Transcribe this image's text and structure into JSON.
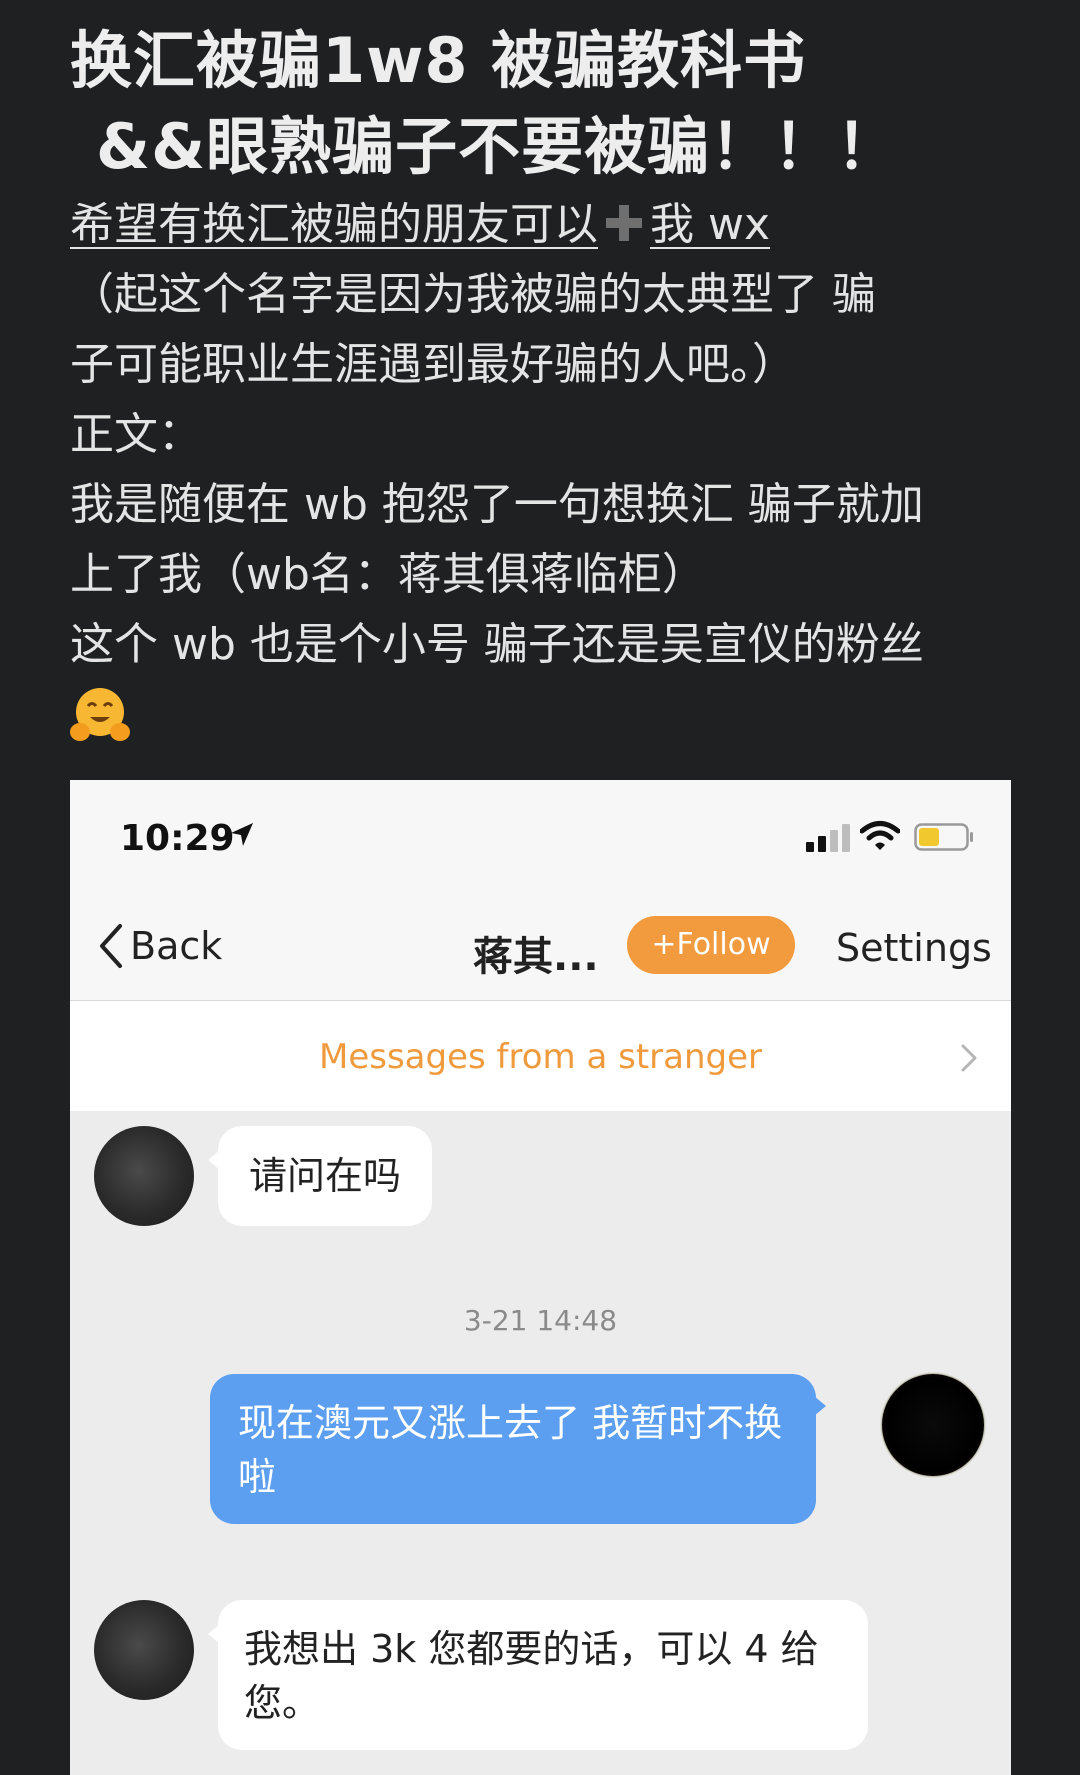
{
  "post": {
    "title_line1": "换汇被骗1w8 被骗教科书",
    "title_line2": "&&眼熟骗子不要被骗！！！",
    "link_line_pre": "希望有换汇被骗的朋友可以",
    "link_line_post": "我 wx",
    "lines": [
      "（起这个名字是因为我被骗的太典型了 骗",
      "子可能职业生涯遇到最好骗的人吧。）",
      "正文：",
      "我是随便在 wb 抱怨了一句想换汇 骗子就加",
      "上了我（wb名：蒋其俱蒋临柜）",
      "这个 wb 也是个小号 骗子还是吴宣仪的粉丝"
    ],
    "emoji": "hugging-face-emoji"
  },
  "phone": {
    "status_bar": {
      "time": "10:29"
    },
    "nav": {
      "back_label": "Back",
      "title": "蒋其...",
      "follow_label": "+Follow",
      "settings_label": "Settings"
    },
    "stranger_banner": "Messages from a stranger",
    "messages": [
      {
        "from": "other",
        "text": "请问在吗"
      },
      {
        "timestamp": "3-21 14:48"
      },
      {
        "from": "me",
        "lines": [
          "现在澳元又涨上去了 我暂时不换",
          "啦"
        ]
      },
      {
        "from": "other",
        "lines": [
          "我想出 3k 您都要的话，可以 4 给",
          "您。"
        ]
      }
    ],
    "colors": {
      "follow": "#f19a3e",
      "banner_text": "#f09a3e",
      "outgoing_bubble": "#5c9ff0",
      "incoming_bubble": "#ffffff"
    }
  }
}
